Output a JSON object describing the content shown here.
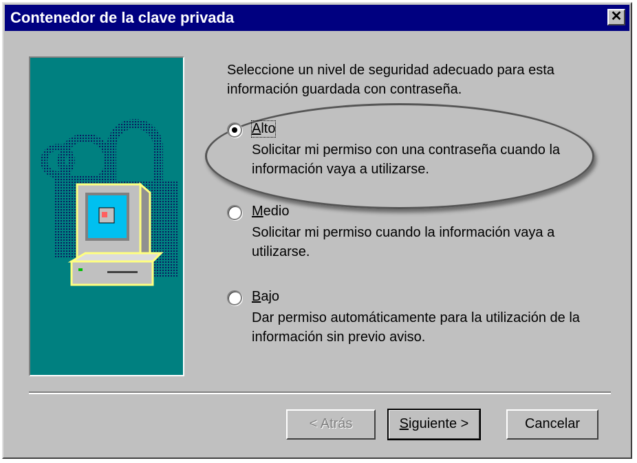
{
  "window": {
    "title": "Contenedor de la clave privada",
    "close_glyph": "✕"
  },
  "intro_text": "Seleccione un nivel de seguridad adecuado para esta información guardada con contraseña.",
  "options": [
    {
      "label_prefix": "",
      "mnemonic": "A",
      "label_rest": "lto",
      "description": "Solicitar mi permiso con una contraseña cuando la información vaya a utilizarse.",
      "selected": true
    },
    {
      "label_prefix": "",
      "mnemonic": "M",
      "label_rest": "edio",
      "description": "Solicitar mi permiso cuando la información vaya a utilizarse.",
      "selected": false
    },
    {
      "label_prefix": "",
      "mnemonic": "B",
      "label_rest": "ajo",
      "description": "Dar permiso automáticamente para la utilización de la información sin previo aviso.",
      "selected": false
    }
  ],
  "buttons": {
    "back": "< Atrás",
    "next_mnemonic": "S",
    "next_rest": "iguiente >",
    "cancel": "Cancelar"
  },
  "colors": {
    "titlebar": "#000080",
    "art_background": "#008080",
    "dialog_face": "#c0c0c0"
  },
  "icons": [
    "padlock-icon",
    "computer-icon"
  ]
}
